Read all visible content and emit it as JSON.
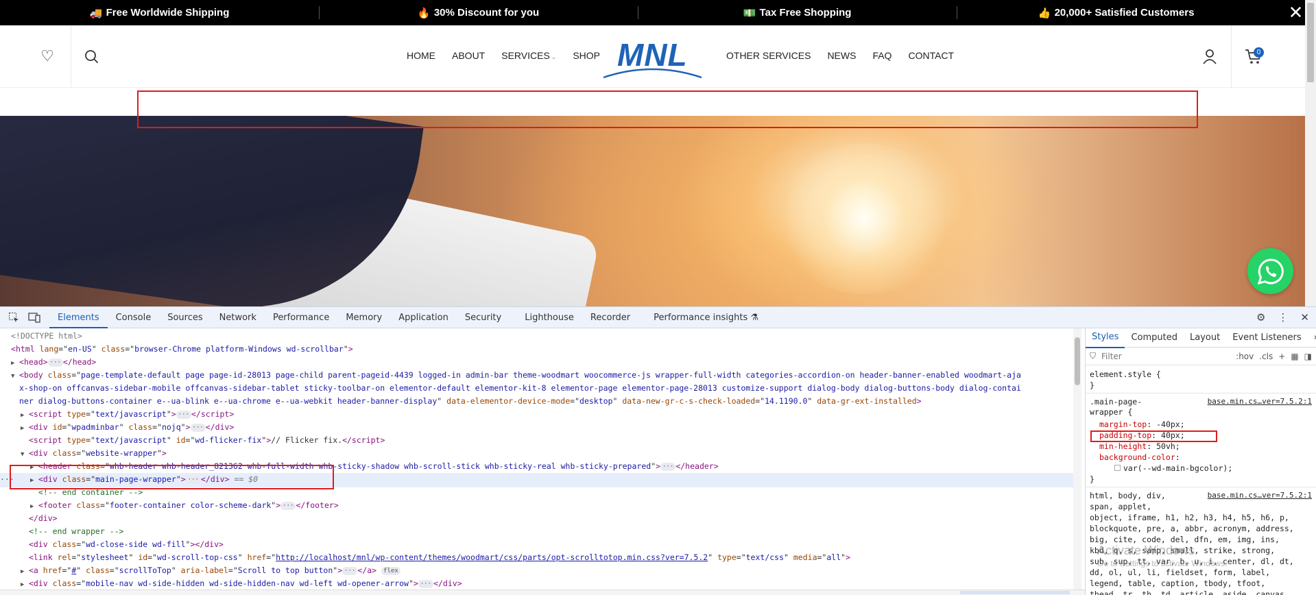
{
  "topbar": {
    "items": [
      {
        "icon": "truck-icon",
        "glyph": "🚚",
        "label": "Free Worldwide Shipping"
      },
      {
        "icon": "flame-icon",
        "glyph": "🔥",
        "label": "30% Discount for you"
      },
      {
        "icon": "money-icon",
        "glyph": "💵",
        "label": "Tax Free Shopping"
      },
      {
        "icon": "thumbs-up-icon",
        "glyph": "👍",
        "label": "20,000+ Satisfied Customers"
      }
    ],
    "close_glyph": "✕"
  },
  "header": {
    "wishlist_glyph": "♡",
    "nav_left": [
      "HOME",
      "ABOUT",
      "SERVICES",
      "SHOP"
    ],
    "nav_right": [
      "OTHER SERVICES",
      "NEWS",
      "FAQ",
      "CONTACT"
    ],
    "logo_text": "MNL",
    "cart_count": "0"
  },
  "devtools": {
    "tabs": [
      "Elements",
      "Console",
      "Sources",
      "Network",
      "Performance",
      "Memory",
      "Application",
      "Security",
      "Lighthouse",
      "Recorder",
      "Performance insights"
    ],
    "active_tab": "Elements",
    "styles_tabs": [
      "Styles",
      "Computed",
      "Layout",
      "Event Listeners"
    ],
    "filter_placeholder": "Filter",
    "hov": ":hov",
    "cls": ".cls",
    "elements": {
      "doctype": "<!DOCTYPE html>",
      "html_tag": "html",
      "html_lang": "en-US",
      "html_class": "browser-Chrome platform-Windows wd-scrollbar",
      "head_tag": "head",
      "body_class_1": "page-template-default page page-id-28013 page-child parent-pageid-4439 logged-in admin-bar theme-woodmart woocommerce-js wrapper-full-width categories-accordion-on header-banner-enabled woodmart-aja",
      "body_class_2": "x-shop-on offcanvas-sidebar-mobile offcanvas-sidebar-tablet sticky-toolbar-on elementor-default elementor-kit-8 elementor-page elementor-page-28013 customize-support dialog-body dialog-buttons-body dialog-contai",
      "body_class_3": "ner dialog-buttons-container e--ua-blink e--ua-chrome e--ua-webkit header-banner-display",
      "body_attr_1": "desktop",
      "body_attr_2": "14.1190.0",
      "script_type": "text/javascript",
      "wpadminbar_id": "wpadminbar",
      "nojq": "nojq",
      "flicker_id": "wd-flicker-fix",
      "flicker_text": "// Flicker fix.",
      "website_wrapper": "website-wrapper",
      "header_class": "whb-header whb-header_821362 whb-full-width whb-sticky-shadow whb-scroll-stick whb-sticky-real whb-sticky-prepared",
      "main_wrapper": "main-page-wrapper",
      "selected_suffix": "== $0",
      "end_container": "<!-- end container -->",
      "footer_class": "footer-container color-scheme-dark",
      "end_wrapper": "<!-- end wrapper -->",
      "close_side": "wd-close-side wd-fill",
      "link_id": "wd-scroll-top-css",
      "link_href": "http://localhost/mnl/wp-content/themes/woodmart/css/parts/opt-scrolltotop.min.css?ver=7.5.2",
      "link_media": "all",
      "a_href": "#",
      "a_class": "scrollToTop",
      "a_label": "Scroll to top button",
      "flex_badge": "flex",
      "mobile_nav_class": "mobile-nav wd-side-hidden wd-side-hidden-nav wd-left wd-opener-arrow"
    },
    "styles": {
      "element_style": "element.style {",
      "close_brace": "}",
      "rule1_selector": ".main-page-",
      "rule1_selector_2": "wrapper {",
      "rule1_source": "base.min.cs…ver=7.5.2:1",
      "rule1_props": [
        {
          "name": "margin-top",
          "value": "-40px;"
        },
        {
          "name": "padding-top",
          "value": "40px;"
        },
        {
          "name": "min-height",
          "value": "50vh;"
        },
        {
          "name": "background-color",
          "value": ""
        }
      ],
      "rule1_var": "var(--wd-main-bgcolor);",
      "rule2_source": "base.min.cs…ver=7.5.2:1",
      "rule2_lines": [
        "html, body, div,",
        "span, applet,",
        "object, iframe, h1, h2, h3, h4, h5, h6, p,",
        "blockquote, pre, a, abbr, acronym, address,",
        "big, cite, code, del, dfn, em, img, ins,",
        "kbd, q, s, samp, small, strike, strong,",
        "sub, sup, tt, var, b, u, i, center, dl, dt,",
        "dd, ol, ul, li, fieldset, form, label,",
        "legend, table, caption, tbody, tfoot,",
        "thead, tr, th, td, article, aside, canvas,"
      ],
      "watermark_1": "Activate Windows",
      "watermark_2": "Go to Settings to activate Windows."
    }
  },
  "colors": {
    "accent": "#1e63b8",
    "highlight": "#e01b1b",
    "whatsapp": "#25d366"
  }
}
